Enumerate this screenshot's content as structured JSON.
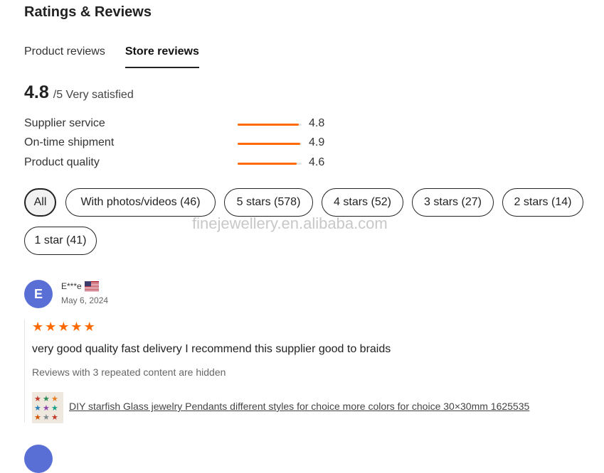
{
  "header": {
    "title": "Ratings & Reviews"
  },
  "tabs": [
    {
      "label": "Product reviews",
      "active": false
    },
    {
      "label": "Store reviews",
      "active": true
    }
  ],
  "overall": {
    "score": "4.8",
    "suffix": "/5 Very satisfied"
  },
  "metrics": [
    {
      "label": "Supplier service",
      "value": "4.8",
      "fraction": 0.96
    },
    {
      "label": "On-time shipment",
      "value": "4.9",
      "fraction": 0.98
    },
    {
      "label": "Product quality",
      "value": "4.6",
      "fraction": 0.92
    }
  ],
  "filters": [
    {
      "label": "All",
      "active": true
    },
    {
      "label": "With photos/videos (46)",
      "active": false
    },
    {
      "label": "5 stars (578)",
      "active": false
    },
    {
      "label": "4 stars (52)",
      "active": false
    },
    {
      "label": "3 stars (27)",
      "active": false
    },
    {
      "label": "2 stars (14)",
      "active": false
    },
    {
      "label": "1 star (41)",
      "active": false
    }
  ],
  "watermark": "finejewellery.en.alibaba.com",
  "reviews": [
    {
      "avatar_letter": "E",
      "name": "E***e",
      "country_flag": "us-flag-icon",
      "date": "May 6, 2024",
      "rating": 5,
      "text": "very good quality fast delivery I recommend this supplier good to braids",
      "hidden_note": "Reviews with 3 repeated content are hidden",
      "product_link": "DIY starfish Glass jewelry Pendants different styles for choice more colors for choice 30×30mm 1625535"
    }
  ],
  "colors": {
    "accent": "#ff6a00",
    "avatar": "#5a6fd6",
    "track": "#e6e6e6"
  }
}
